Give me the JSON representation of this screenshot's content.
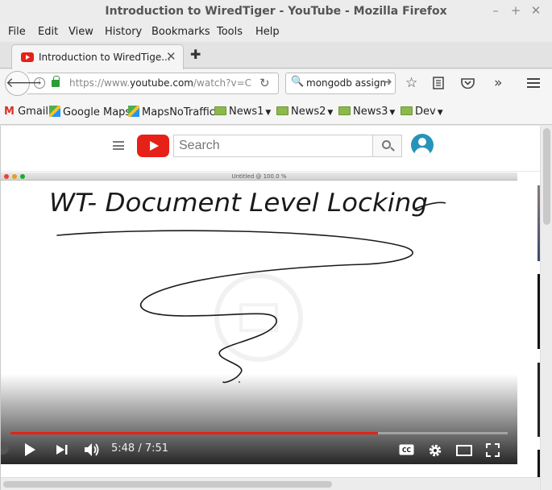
{
  "window": {
    "title": "Introduction to WiredTiger - YouTube - Mozilla Firefox",
    "controls": [
      "–",
      "+",
      "✕"
    ]
  },
  "menu": [
    "File",
    "Edit",
    "View",
    "History",
    "Bookmarks",
    "Tools",
    "Help"
  ],
  "tab": {
    "label": "Introduction to WiredTige...",
    "close": "✕",
    "new_tab": "✚"
  },
  "nav": {
    "url_prefix": "https://www.",
    "url_domain": "youtube.com",
    "url_rest": "/watch?v=C",
    "search_text": "mongodb assign"
  },
  "bookmarks": [
    {
      "label": "Gmail"
    },
    {
      "label": "Google Maps"
    },
    {
      "label": "MapsNoTraffic"
    },
    {
      "label": "News1"
    },
    {
      "label": "News2"
    },
    {
      "label": "News3"
    },
    {
      "label": "Dev"
    }
  ],
  "youtube": {
    "search_placeholder": "Search",
    "video": {
      "window_title": "Untitled @ 100.0 %",
      "handwriting_title": "WT- Document Level Locking",
      "current_time": "5:48",
      "duration": "7:51",
      "time_display": "5:48 / 7:51",
      "progress_fraction": 0.739
    }
  },
  "colors": {
    "youtube_red": "#e62117",
    "lock_green": "#2c9a3a",
    "avatar_blue": "#2793b8"
  }
}
